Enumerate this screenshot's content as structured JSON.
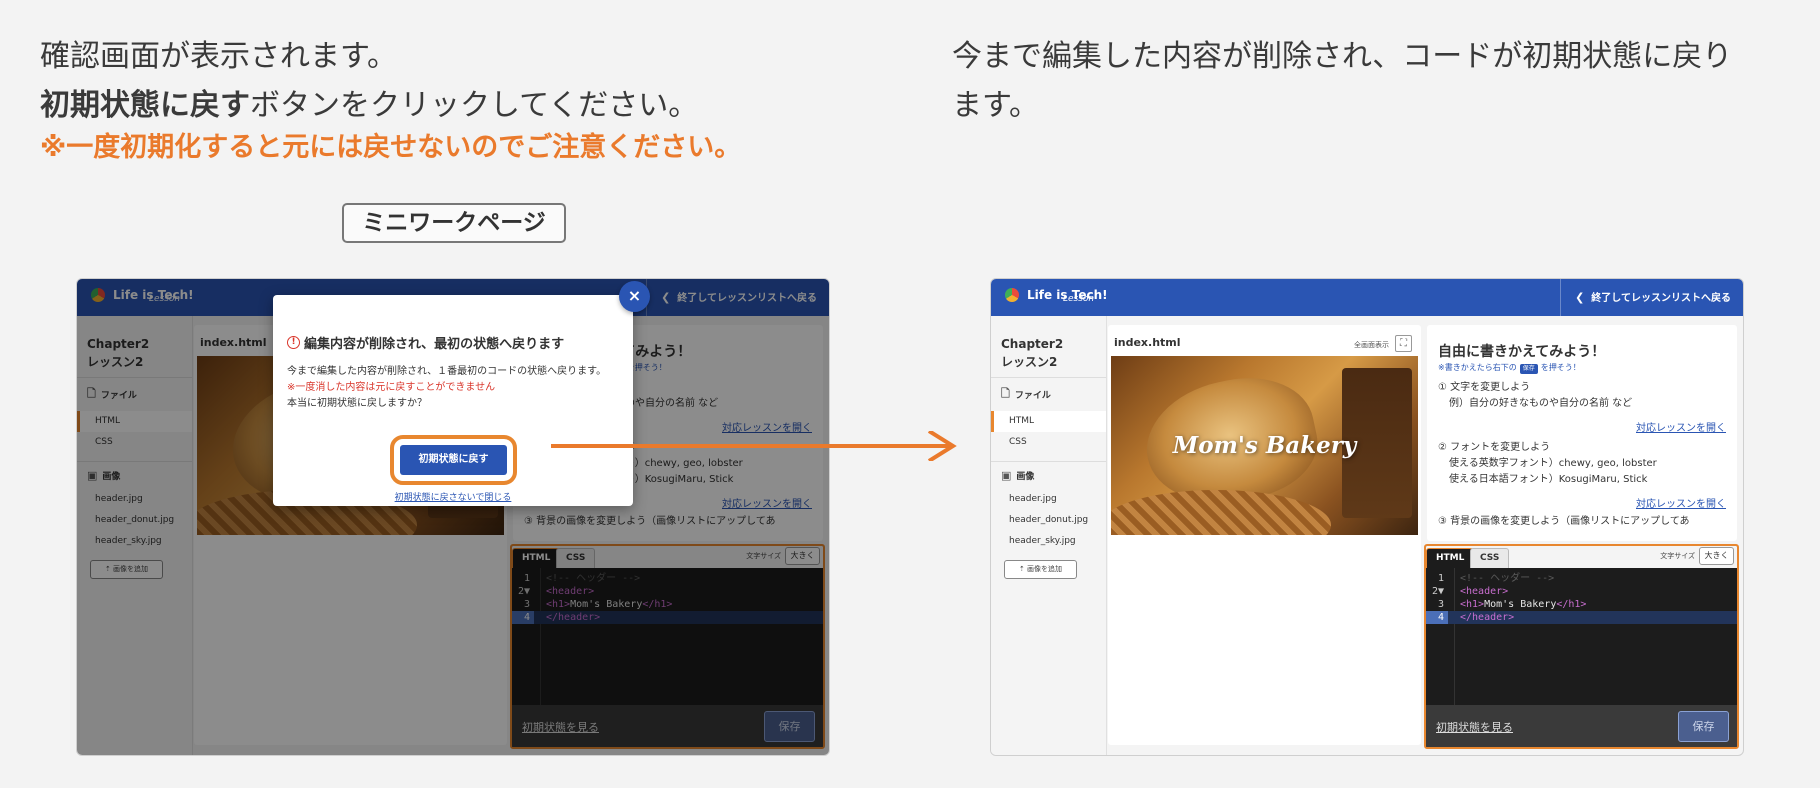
{
  "captions": {
    "left_line1": "確認画面が表示されます。",
    "left_line2_bold": "初期状態に戻す",
    "left_line2_rest": "ボタンをクリックしてください。",
    "left_warning": "※一度初期化すると元には戻せないのでご注意ください。",
    "right_text": "今まで編集した内容が削除され、コードが初期状態に戻ります。"
  },
  "page_tag": "ミニワークページ",
  "app": {
    "brand": "Life is Tech!",
    "brand_sub": "Lesson",
    "back_label": "終了してレッスンリストへ戻る",
    "lesson_title_1": "Chapter2",
    "lesson_title_2": "レッスン2",
    "files_section": "ファイル",
    "files": [
      "HTML",
      "CSS"
    ],
    "images_section": "画像",
    "images": [
      "header.jpg",
      "header_donut.jpg",
      "header_sky.jpg"
    ],
    "add_image": "画像を追加",
    "preview_title": "index.html",
    "fullscreen_label": "全画面表示",
    "preview_brand": "Mom's Bakery",
    "instructions": {
      "title": "自由に書きかえてみよう！",
      "sub_before": "書きかえたら右下の",
      "sub_pill": "保存",
      "sub_after": "を押そう！",
      "item1_title": "文字を変更しよう",
      "item1_example": "例）自分の好きなものや自分の名前 など",
      "link": "対応レッスンを開く",
      "item2_title": "フォントを変更しよう",
      "item2_en": "使える英数字フォント）chewy, geo, lobster",
      "item2_jp": "使える日本語フォント）KosugiMaru, Stick",
      "item3_title": "背景の画像を変更しよう（画像リストにアップしてあ"
    },
    "editor": {
      "tab_html": "HTML",
      "tab_css": "CSS",
      "font_size_label": "文字サイズ",
      "font_size_btn": "大きく",
      "lines": [
        {
          "n": "1",
          "marker": " ",
          "parts": [
            [
              "com",
              "<!-- ヘッダー -->"
            ]
          ]
        },
        {
          "n": "2",
          "marker": "▼",
          "parts": [
            [
              "tag",
              "<header>"
            ]
          ]
        },
        {
          "n": "3",
          "marker": " ",
          "parts": [
            [
              "tag",
              "<h1>"
            ],
            [
              "txt",
              "Mom's Bakery"
            ],
            [
              "tag",
              "</h1>"
            ]
          ]
        },
        {
          "n": "4",
          "marker": " ",
          "parts": [
            [
              "tag",
              "</header>"
            ]
          ]
        }
      ],
      "reset_link": "初期状態を見る",
      "save_btn": "保存"
    }
  },
  "modal": {
    "title": "編集内容が削除され、最初の状態へ戻ります",
    "body": "今まで編集した内容が削除され、１番最初のコードの状態へ戻ります。",
    "warning": "※一度消した内容は元に戻すことができません",
    "question": "本当に初期状態に戻しますか？",
    "confirm_btn": "初期状態に戻す",
    "cancel_link": "初期状態に戻さないで閉じる",
    "close_glyph": "×"
  },
  "colors": {
    "accent_orange": "#e8872f",
    "brand_blue": "#2a55b3"
  }
}
